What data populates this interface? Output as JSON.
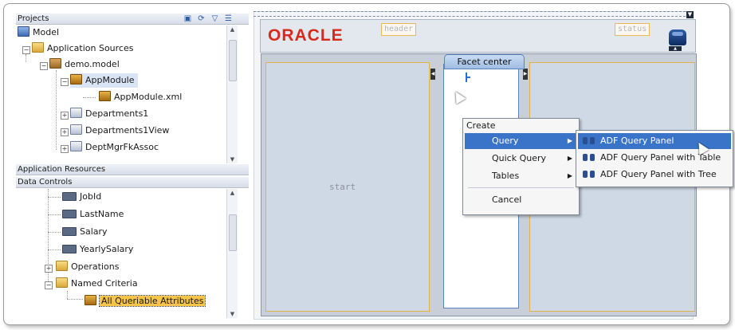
{
  "navigator": {
    "projects_title": "Projects",
    "app_sources_title": "Application Resources",
    "data_controls_title": "Data Controls",
    "project_tree": [
      {
        "label": "Model",
        "icon": "model-icon"
      },
      {
        "label": "Application Sources",
        "icon": "folder-icon"
      },
      {
        "label": "demo.model",
        "icon": "package-icon"
      },
      {
        "label": "AppModule",
        "icon": "app-module-icon"
      },
      {
        "label": "AppModule.xml",
        "icon": "app-module-icon"
      },
      {
        "label": "Departments1",
        "icon": "view-object-icon"
      },
      {
        "label": "Departments1View",
        "icon": "view-object-icon"
      },
      {
        "label": "DeptMgrFkAssoc",
        "icon": "association-icon"
      }
    ],
    "data_tree": [
      {
        "label": "JobId",
        "icon": "attribute-icon"
      },
      {
        "label": "LastName",
        "icon": "attribute-icon"
      },
      {
        "label": "Salary",
        "icon": "attribute-icon"
      },
      {
        "label": "YearlySalary",
        "icon": "attribute-icon"
      },
      {
        "label": "Operations",
        "icon": "folder-icon"
      },
      {
        "label": "Named Criteria",
        "icon": "folder-icon"
      },
      {
        "label": "All Queriable Attributes",
        "icon": "view-criteria-icon"
      }
    ]
  },
  "design": {
    "brand": "ORACLE",
    "header_tag": "header",
    "status_tag": "status",
    "start_label": "start",
    "center_facet": "Facet  center"
  },
  "context_menu": {
    "title": "Create",
    "items": [
      "Query",
      "Quick Query",
      "Tables"
    ],
    "cancel": "Cancel",
    "highlighted": "Query"
  },
  "submenu": {
    "items": [
      "ADF Query Panel",
      "ADF Query Panel with Table",
      "ADF Query Panel with Tree"
    ],
    "highlighted": "ADF Query Panel"
  },
  "colors": {
    "menu_highlight": "#3a74c9",
    "brand": "#d8291d",
    "region_border": "#e4b24a"
  }
}
